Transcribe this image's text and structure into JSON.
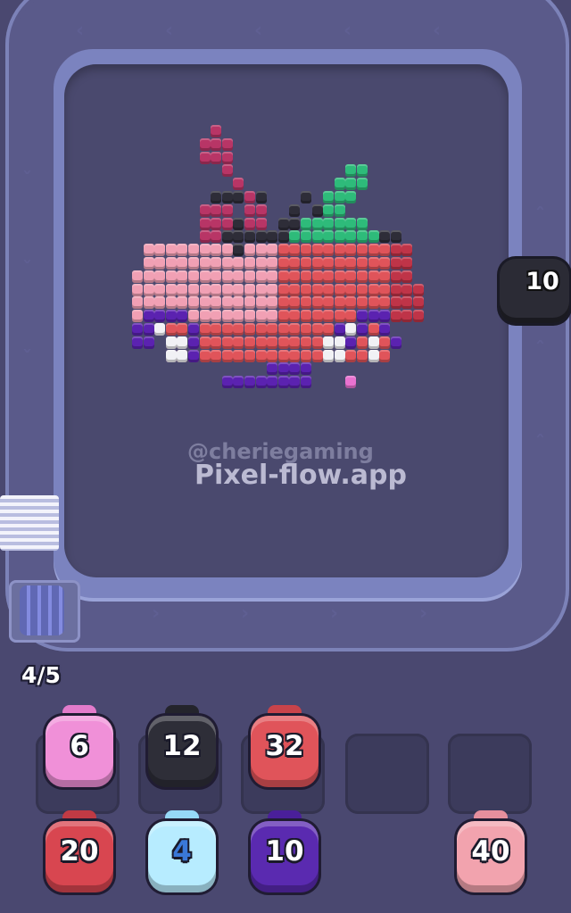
{
  "watermark": {
    "handle": "@cheriegaming",
    "site": "Pixel-flow.app"
  },
  "queue": {
    "count_label": "4/5"
  },
  "track_unit": {
    "value": "10",
    "color": "#2b2b35"
  },
  "shooters": [
    {
      "value": "6",
      "color": "#f090d8",
      "cap": "#e37bcb",
      "text_color": "#ffffff"
    },
    {
      "value": "12",
      "color": "#2e2e38",
      "cap": "#24242c",
      "text_color": "#ffffff"
    },
    {
      "value": "32",
      "color": "#e0545a",
      "cap": "#c8434a",
      "text_color": "#ffffff"
    },
    {
      "value": "20",
      "color": "#d84650",
      "cap": "#c03a44",
      "text_color": "#ffffff"
    },
    {
      "value": "4",
      "color": "#b7ecff",
      "cap": "#96d9f7",
      "text_color": "#3a78d8"
    },
    {
      "value": "10",
      "color": "#5a2ab0",
      "cap": "#4a1f9a",
      "text_color": "#ffffff"
    },
    {
      "value": "40",
      "color": "#f2a3ae",
      "cap": "#e58f9d",
      "text_color": "#ffffff"
    }
  ],
  "palette": {
    "black": "#2e2d38",
    "green": "#2ebb7a",
    "light_pink": "#f1a0b4",
    "red": "#e0545a",
    "dark_red": "#bf3448",
    "magenta": "#b83566",
    "purple": "#5b22b0",
    "white": "#f1f1f5",
    "hot_pink": "#e872d0"
  },
  "pixel_art": [
    "..........BB....................",
    ".......BBBB....................."
  ]
}
